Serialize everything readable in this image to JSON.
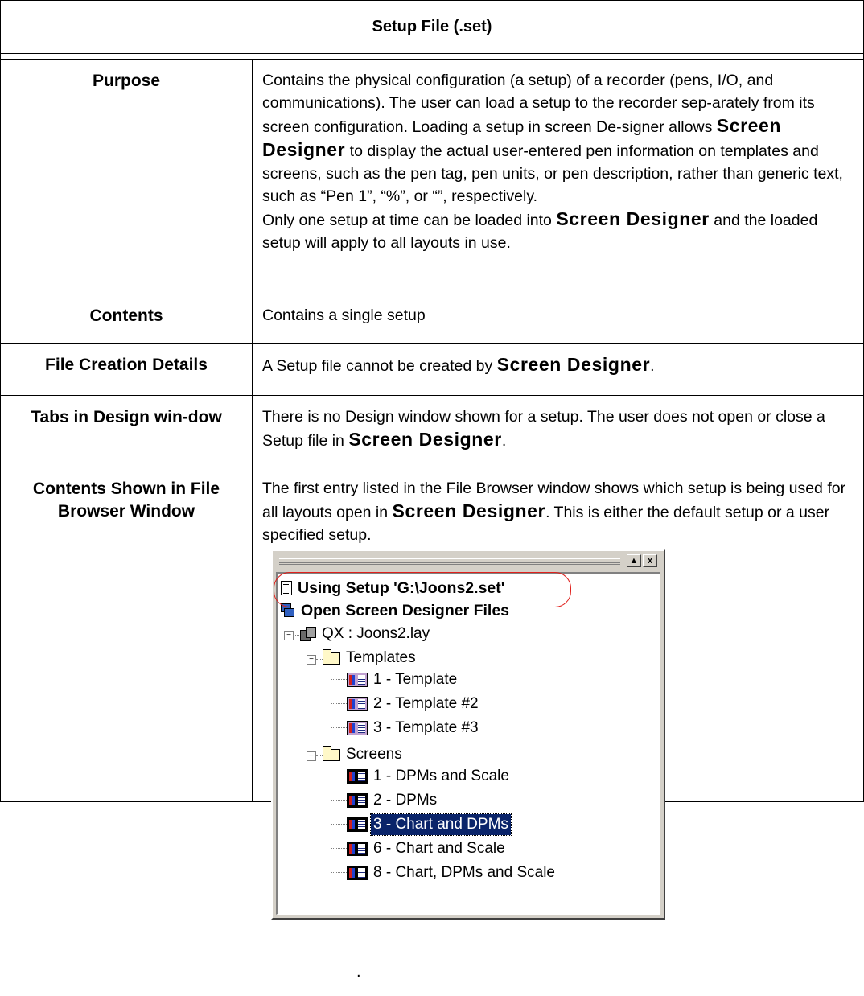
{
  "table": {
    "title": "Setup File (.set)",
    "rows": [
      {
        "label": "Purpose",
        "text_parts": [
          "Contains the physical configuration (a setup) of a recorder (pens, I/O, and communications). The user can load a setup to the recorder sep-arately from its screen configuration. Loading a setup in screen De-signer allows ",
          "Screen Designer",
          " to display the actual user-entered pen information on templates and screens, such as the pen tag, pen units, or pen description, rather than generic text, such as “Pen 1”, “%”, or “”, respectively.",
          "Only one setup at time can be loaded into ",
          "Screen Designer",
          " and the loaded setup will apply to all layouts in use."
        ]
      },
      {
        "label": "Contents",
        "text": "Contains a single setup"
      },
      {
        "label": "File Creation Details",
        "text_parts": [
          "A Setup file cannot be created by ",
          "Screen Designer",
          "."
        ]
      },
      {
        "label": "Tabs in Design win-dow",
        "text_parts": [
          "There is no Design window shown for a setup. The user does not open or close a Setup file in ",
          "Screen Designer",
          "."
        ]
      },
      {
        "label": "Contents Shown in File Browser Window",
        "text_parts": [
          "The first entry listed in the File Browser window shows which setup is being used for all layouts open in ",
          "Screen Designer",
          ". This is either the default setup or a user specified setup."
        ],
        "trailing": "."
      }
    ]
  },
  "file_browser": {
    "window_buttons": {
      "up": "▲",
      "close": "x"
    },
    "using_setup": "Using Setup 'G:\\Joons2.set'",
    "open_files": "Open Screen Designer Files",
    "layout": "QX : Joons2.lay",
    "templates_folder": "Templates",
    "templates": [
      "1 - Template",
      "2 - Template #2",
      "3 - Template #3"
    ],
    "screens_folder": "Screens",
    "screens": [
      "1 - DPMs and Scale",
      "2 - DPMs",
      "3 - Chart and DPMs",
      "6 - Chart and Scale",
      "8 - Chart, DPMs and Scale"
    ],
    "selected_screen": "3 - Chart and DPMs",
    "highlight_color": "#e0201c",
    "selection_color": "#0a246a"
  }
}
